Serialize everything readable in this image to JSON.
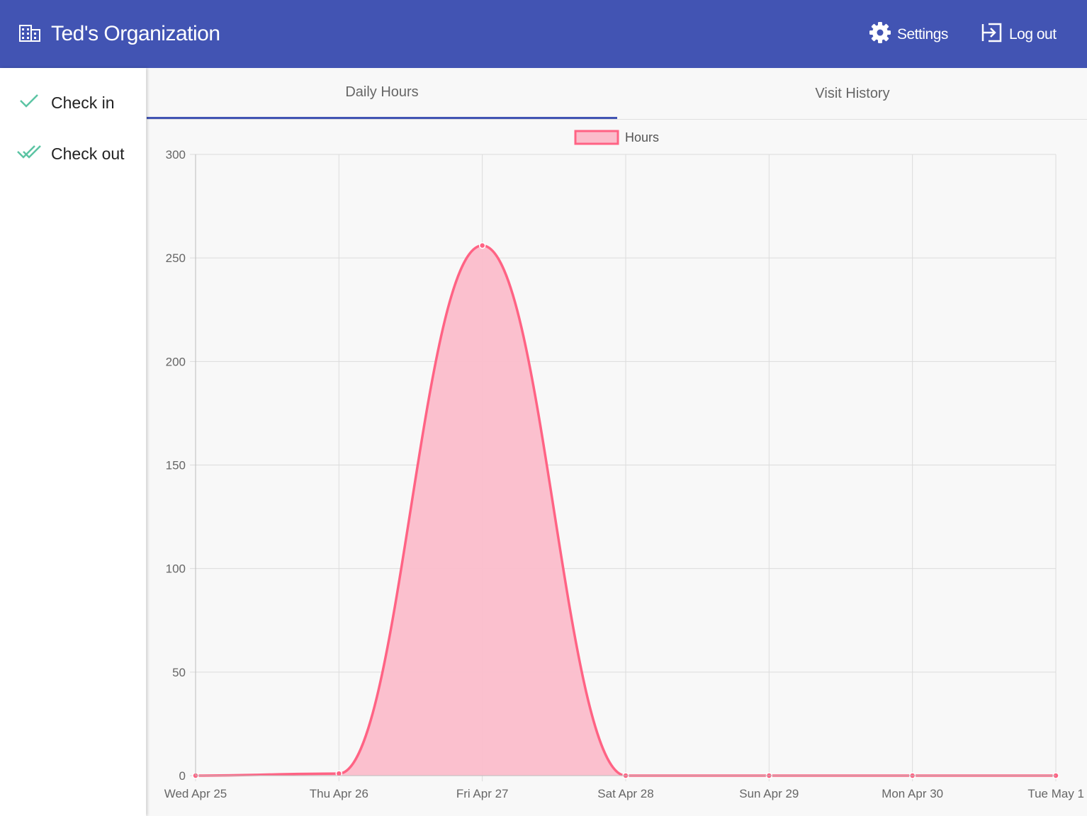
{
  "app": {
    "org_name": "Ted's Organization",
    "org_icon": "building-icon"
  },
  "header": {
    "settings_label": "Settings",
    "settings_icon": "gear-icon",
    "logout_label": "Log out",
    "logout_icon": "logout-icon"
  },
  "sidebar": {
    "items": [
      {
        "label": "Check in",
        "icon": "check-icon"
      },
      {
        "label": "Check out",
        "icon": "double-check-icon"
      }
    ]
  },
  "tabs": [
    {
      "label": "Daily Hours",
      "active": true
    },
    {
      "label": "Visit History",
      "active": false
    }
  ],
  "colors": {
    "header": "#4254b3",
    "accent": "#4254b3",
    "sidebar_icon": "#5cc4a4",
    "series_line": "#ff6384",
    "series_fill": "#fbbdcb"
  },
  "chart_data": {
    "type": "line",
    "area_fill": true,
    "smooth": true,
    "legend": "top",
    "grid": true,
    "categories": [
      "Wed Apr 25",
      "Thu Apr 26",
      "Fri Apr 27",
      "Sat Apr 28",
      "Sun Apr 29",
      "Mon Apr 30",
      "Tue May 1"
    ],
    "series": [
      {
        "name": "Hours",
        "values": [
          0,
          1,
          256,
          0,
          0,
          0,
          0
        ]
      }
    ],
    "ylim": [
      0,
      300
    ],
    "yticks": [
      0,
      50,
      100,
      150,
      200,
      250,
      300
    ]
  }
}
